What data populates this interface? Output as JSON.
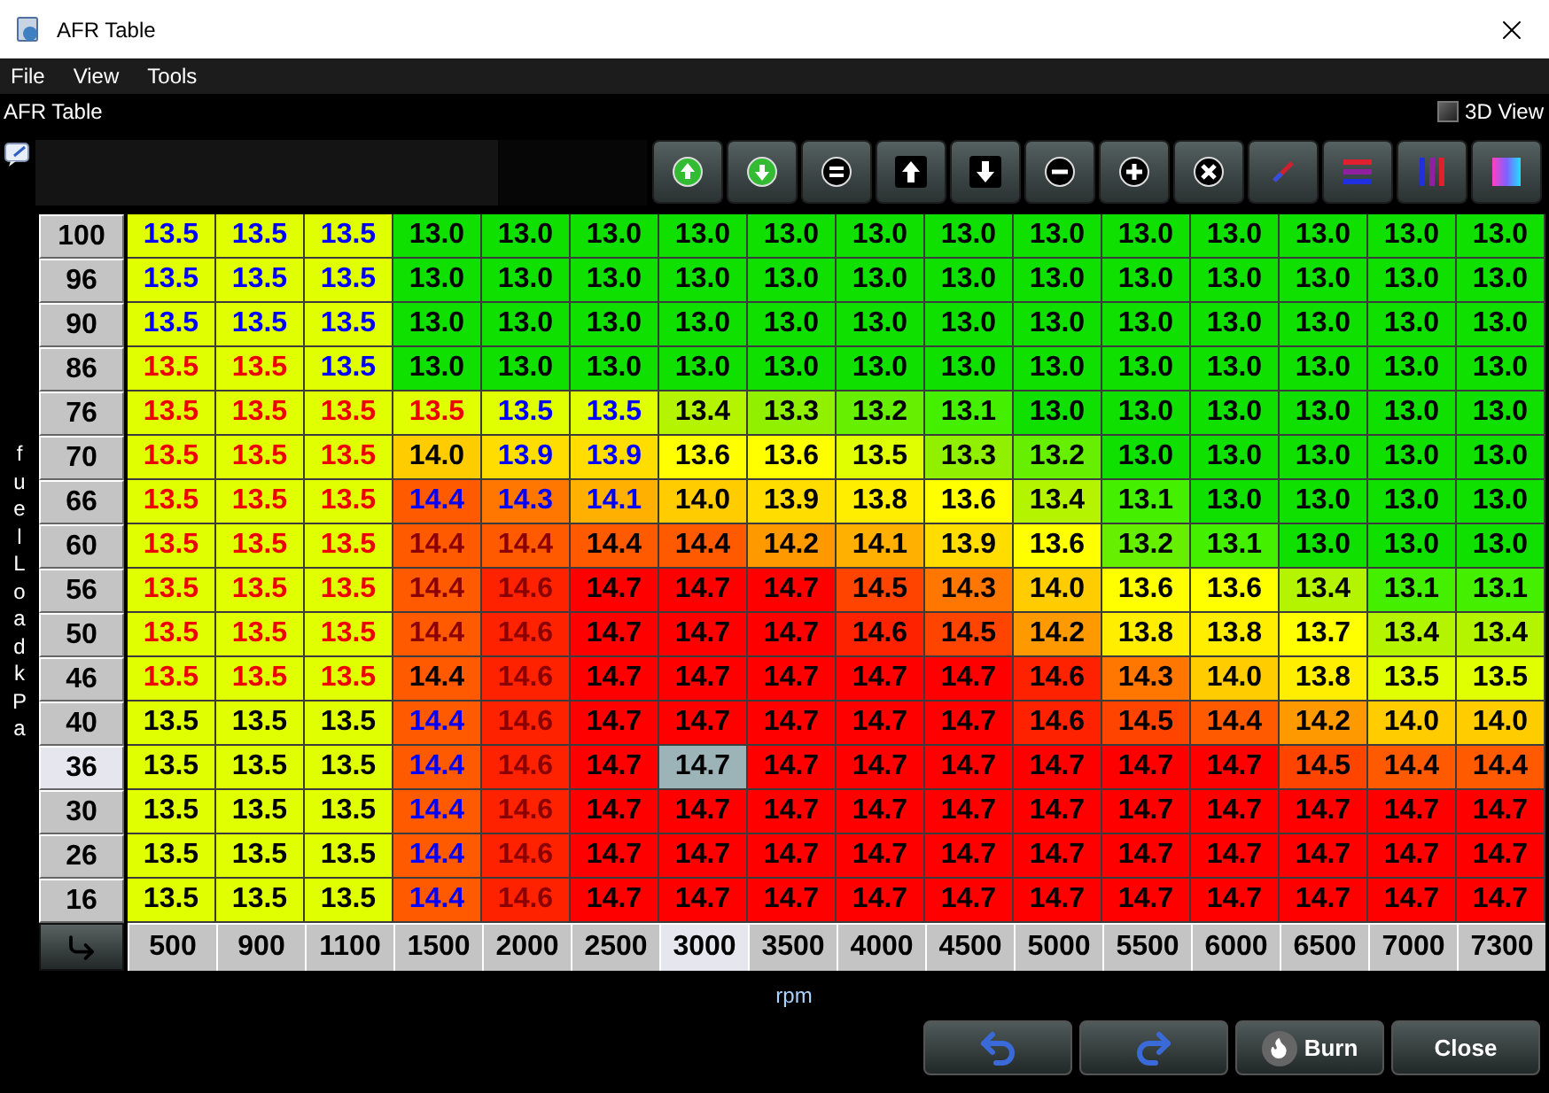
{
  "window": {
    "title": "AFR Table"
  },
  "menu": [
    {
      "label": "File"
    },
    {
      "label": "View"
    },
    {
      "label": "Tools"
    }
  ],
  "panel": {
    "title": "AFR Table",
    "view_toggle": {
      "label": "3D View",
      "checked": false
    }
  },
  "y_axis_label": "fuelLoad kPa",
  "x_axis_label": "rpm",
  "columns": [
    {
      "label": "500",
      "selected": false
    },
    {
      "label": "900",
      "selected": false
    },
    {
      "label": "1100",
      "selected": false
    },
    {
      "label": "1500",
      "selected": false
    },
    {
      "label": "2000",
      "selected": false
    },
    {
      "label": "2500",
      "selected": false
    },
    {
      "label": "3000",
      "selected": true
    },
    {
      "label": "3500",
      "selected": false
    },
    {
      "label": "4000",
      "selected": false
    },
    {
      "label": "4500",
      "selected": false
    },
    {
      "label": "5000",
      "selected": false
    },
    {
      "label": "5500",
      "selected": false
    },
    {
      "label": "6000",
      "selected": false
    },
    {
      "label": "6500",
      "selected": false
    },
    {
      "label": "7000",
      "selected": false
    },
    {
      "label": "7300",
      "selected": false
    }
  ],
  "rows": [
    {
      "label": "100",
      "selected": false,
      "cells": [
        {
          "value": "13.5",
          "color": "#e0ff00",
          "kind": "blue"
        },
        {
          "value": "13.5",
          "color": "#e0ff00",
          "kind": "blue"
        },
        {
          "value": "13.5",
          "color": "#e0ff00",
          "kind": "blue"
        },
        {
          "value": "13.0",
          "color": "#10e000",
          "kind": "plain"
        },
        {
          "value": "13.0",
          "color": "#10e000",
          "kind": "plain"
        },
        {
          "value": "13.0",
          "color": "#10e000",
          "kind": "plain"
        },
        {
          "value": "13.0",
          "color": "#10e000",
          "kind": "plain"
        },
        {
          "value": "13.0",
          "color": "#10e000",
          "kind": "plain"
        },
        {
          "value": "13.0",
          "color": "#10e000",
          "kind": "plain"
        },
        {
          "value": "13.0",
          "color": "#10e000",
          "kind": "plain"
        },
        {
          "value": "13.0",
          "color": "#10e000",
          "kind": "plain"
        },
        {
          "value": "13.0",
          "color": "#10e000",
          "kind": "plain"
        },
        {
          "value": "13.0",
          "color": "#10e000",
          "kind": "plain"
        },
        {
          "value": "13.0",
          "color": "#10e000",
          "kind": "plain"
        },
        {
          "value": "13.0",
          "color": "#10e000",
          "kind": "plain"
        },
        {
          "value": "13.0",
          "color": "#10e000",
          "kind": "plain"
        }
      ]
    },
    {
      "label": "96",
      "selected": false,
      "cells": [
        {
          "value": "13.5",
          "color": "#e0ff00",
          "kind": "blue"
        },
        {
          "value": "13.5",
          "color": "#e0ff00",
          "kind": "blue"
        },
        {
          "value": "13.5",
          "color": "#e0ff00",
          "kind": "blue"
        },
        {
          "value": "13.0",
          "color": "#10e000",
          "kind": "plain"
        },
        {
          "value": "13.0",
          "color": "#10e000",
          "kind": "plain"
        },
        {
          "value": "13.0",
          "color": "#10e000",
          "kind": "plain"
        },
        {
          "value": "13.0",
          "color": "#10e000",
          "kind": "plain"
        },
        {
          "value": "13.0",
          "color": "#10e000",
          "kind": "plain"
        },
        {
          "value": "13.0",
          "color": "#10e000",
          "kind": "plain"
        },
        {
          "value": "13.0",
          "color": "#10e000",
          "kind": "plain"
        },
        {
          "value": "13.0",
          "color": "#10e000",
          "kind": "plain"
        },
        {
          "value": "13.0",
          "color": "#10e000",
          "kind": "plain"
        },
        {
          "value": "13.0",
          "color": "#10e000",
          "kind": "plain"
        },
        {
          "value": "13.0",
          "color": "#10e000",
          "kind": "plain"
        },
        {
          "value": "13.0",
          "color": "#10e000",
          "kind": "plain"
        },
        {
          "value": "13.0",
          "color": "#10e000",
          "kind": "plain"
        }
      ]
    },
    {
      "label": "90",
      "selected": false,
      "cells": [
        {
          "value": "13.5",
          "color": "#e0ff00",
          "kind": "blue"
        },
        {
          "value": "13.5",
          "color": "#e0ff00",
          "kind": "blue"
        },
        {
          "value": "13.5",
          "color": "#e0ff00",
          "kind": "blue"
        },
        {
          "value": "13.0",
          "color": "#10e000",
          "kind": "plain"
        },
        {
          "value": "13.0",
          "color": "#10e000",
          "kind": "plain"
        },
        {
          "value": "13.0",
          "color": "#10e000",
          "kind": "plain"
        },
        {
          "value": "13.0",
          "color": "#10e000",
          "kind": "plain"
        },
        {
          "value": "13.0",
          "color": "#10e000",
          "kind": "plain"
        },
        {
          "value": "13.0",
          "color": "#10e000",
          "kind": "plain"
        },
        {
          "value": "13.0",
          "color": "#10e000",
          "kind": "plain"
        },
        {
          "value": "13.0",
          "color": "#10e000",
          "kind": "plain"
        },
        {
          "value": "13.0",
          "color": "#10e000",
          "kind": "plain"
        },
        {
          "value": "13.0",
          "color": "#10e000",
          "kind": "plain"
        },
        {
          "value": "13.0",
          "color": "#10e000",
          "kind": "plain"
        },
        {
          "value": "13.0",
          "color": "#10e000",
          "kind": "plain"
        },
        {
          "value": "13.0",
          "color": "#10e000",
          "kind": "plain"
        }
      ]
    },
    {
      "label": "86",
      "selected": false,
      "cells": [
        {
          "value": "13.5",
          "color": "#e0ff00",
          "kind": "red"
        },
        {
          "value": "13.5",
          "color": "#e0ff00",
          "kind": "red"
        },
        {
          "value": "13.5",
          "color": "#e0ff00",
          "kind": "blue"
        },
        {
          "value": "13.0",
          "color": "#10e000",
          "kind": "plain"
        },
        {
          "value": "13.0",
          "color": "#10e000",
          "kind": "plain"
        },
        {
          "value": "13.0",
          "color": "#10e000",
          "kind": "plain"
        },
        {
          "value": "13.0",
          "color": "#10e000",
          "kind": "plain"
        },
        {
          "value": "13.0",
          "color": "#10e000",
          "kind": "plain"
        },
        {
          "value": "13.0",
          "color": "#10e000",
          "kind": "plain"
        },
        {
          "value": "13.0",
          "color": "#10e000",
          "kind": "plain"
        },
        {
          "value": "13.0",
          "color": "#10e000",
          "kind": "plain"
        },
        {
          "value": "13.0",
          "color": "#10e000",
          "kind": "plain"
        },
        {
          "value": "13.0",
          "color": "#10e000",
          "kind": "plain"
        },
        {
          "value": "13.0",
          "color": "#10e000",
          "kind": "plain"
        },
        {
          "value": "13.0",
          "color": "#10e000",
          "kind": "plain"
        },
        {
          "value": "13.0",
          "color": "#10e000",
          "kind": "plain"
        }
      ]
    },
    {
      "label": "76",
      "selected": false,
      "cells": [
        {
          "value": "13.5",
          "color": "#e0ff00",
          "kind": "red"
        },
        {
          "value": "13.5",
          "color": "#e0ff00",
          "kind": "red"
        },
        {
          "value": "13.5",
          "color": "#e0ff00",
          "kind": "red"
        },
        {
          "value": "13.5",
          "color": "#e0ff00",
          "kind": "red"
        },
        {
          "value": "13.5",
          "color": "#e0ff00",
          "kind": "blue"
        },
        {
          "value": "13.5",
          "color": "#e0ff00",
          "kind": "blue"
        },
        {
          "value": "13.4",
          "color": "#b4f400",
          "kind": "plain"
        },
        {
          "value": "13.3",
          "color": "#90f000",
          "kind": "plain"
        },
        {
          "value": "13.2",
          "color": "#66f000",
          "kind": "plain"
        },
        {
          "value": "13.1",
          "color": "#44f000",
          "kind": "plain"
        },
        {
          "value": "13.0",
          "color": "#10e000",
          "kind": "plain"
        },
        {
          "value": "13.0",
          "color": "#10e000",
          "kind": "plain"
        },
        {
          "value": "13.0",
          "color": "#10e000",
          "kind": "plain"
        },
        {
          "value": "13.0",
          "color": "#10e000",
          "kind": "plain"
        },
        {
          "value": "13.0",
          "color": "#10e000",
          "kind": "plain"
        },
        {
          "value": "13.0",
          "color": "#10e000",
          "kind": "plain"
        }
      ]
    },
    {
      "label": "70",
      "selected": false,
      "cells": [
        {
          "value": "13.5",
          "color": "#e0ff00",
          "kind": "red"
        },
        {
          "value": "13.5",
          "color": "#e0ff00",
          "kind": "red"
        },
        {
          "value": "13.5",
          "color": "#e0ff00",
          "kind": "red"
        },
        {
          "value": "14.0",
          "color": "#ffcc00",
          "kind": "plain"
        },
        {
          "value": "13.9",
          "color": "#ffdd00",
          "kind": "blue"
        },
        {
          "value": "13.9",
          "color": "#ffdd00",
          "kind": "blue"
        },
        {
          "value": "13.6",
          "color": "#ffff00",
          "kind": "plain"
        },
        {
          "value": "13.6",
          "color": "#ffff00",
          "kind": "plain"
        },
        {
          "value": "13.5",
          "color": "#e0ff00",
          "kind": "plain"
        },
        {
          "value": "13.3",
          "color": "#90f000",
          "kind": "plain"
        },
        {
          "value": "13.2",
          "color": "#66f000",
          "kind": "plain"
        },
        {
          "value": "13.0",
          "color": "#10e000",
          "kind": "plain"
        },
        {
          "value": "13.0",
          "color": "#10e000",
          "kind": "plain"
        },
        {
          "value": "13.0",
          "color": "#10e000",
          "kind": "plain"
        },
        {
          "value": "13.0",
          "color": "#10e000",
          "kind": "plain"
        },
        {
          "value": "13.0",
          "color": "#10e000",
          "kind": "plain"
        }
      ]
    },
    {
      "label": "66",
      "selected": false,
      "cells": [
        {
          "value": "13.5",
          "color": "#e0ff00",
          "kind": "red"
        },
        {
          "value": "13.5",
          "color": "#e0ff00",
          "kind": "red"
        },
        {
          "value": "13.5",
          "color": "#e0ff00",
          "kind": "red"
        },
        {
          "value": "14.4",
          "color": "#ff5a00",
          "kind": "blue"
        },
        {
          "value": "14.3",
          "color": "#ff7700",
          "kind": "blue"
        },
        {
          "value": "14.1",
          "color": "#ffb000",
          "kind": "blue"
        },
        {
          "value": "14.0",
          "color": "#ffcc00",
          "kind": "plain"
        },
        {
          "value": "13.9",
          "color": "#ffdd00",
          "kind": "plain"
        },
        {
          "value": "13.8",
          "color": "#ffee00",
          "kind": "plain"
        },
        {
          "value": "13.6",
          "color": "#ffff00",
          "kind": "plain"
        },
        {
          "value": "13.4",
          "color": "#b4f400",
          "kind": "plain"
        },
        {
          "value": "13.1",
          "color": "#44f000",
          "kind": "plain"
        },
        {
          "value": "13.0",
          "color": "#10e000",
          "kind": "plain"
        },
        {
          "value": "13.0",
          "color": "#10e000",
          "kind": "plain"
        },
        {
          "value": "13.0",
          "color": "#10e000",
          "kind": "plain"
        },
        {
          "value": "13.0",
          "color": "#10e000",
          "kind": "plain"
        }
      ]
    },
    {
      "label": "60",
      "selected": false,
      "cells": [
        {
          "value": "13.5",
          "color": "#e0ff00",
          "kind": "red"
        },
        {
          "value": "13.5",
          "color": "#e0ff00",
          "kind": "red"
        },
        {
          "value": "13.5",
          "color": "#e0ff00",
          "kind": "red"
        },
        {
          "value": "14.4",
          "color": "#ff5a00",
          "kind": "dim"
        },
        {
          "value": "14.4",
          "color": "#ff5a00",
          "kind": "dim"
        },
        {
          "value": "14.4",
          "color": "#ff5a00",
          "kind": "plain"
        },
        {
          "value": "14.4",
          "color": "#ff5a00",
          "kind": "plain"
        },
        {
          "value": "14.2",
          "color": "#ff9900",
          "kind": "plain"
        },
        {
          "value": "14.1",
          "color": "#ffb000",
          "kind": "plain"
        },
        {
          "value": "13.9",
          "color": "#ffdd00",
          "kind": "plain"
        },
        {
          "value": "13.6",
          "color": "#ffff00",
          "kind": "plain"
        },
        {
          "value": "13.2",
          "color": "#66f000",
          "kind": "plain"
        },
        {
          "value": "13.1",
          "color": "#44f000",
          "kind": "plain"
        },
        {
          "value": "13.0",
          "color": "#10e000",
          "kind": "plain"
        },
        {
          "value": "13.0",
          "color": "#10e000",
          "kind": "plain"
        },
        {
          "value": "13.0",
          "color": "#10e000",
          "kind": "plain"
        }
      ]
    },
    {
      "label": "56",
      "selected": false,
      "cells": [
        {
          "value": "13.5",
          "color": "#e0ff00",
          "kind": "red"
        },
        {
          "value": "13.5",
          "color": "#e0ff00",
          "kind": "red"
        },
        {
          "value": "13.5",
          "color": "#e0ff00",
          "kind": "red"
        },
        {
          "value": "14.4",
          "color": "#ff5a00",
          "kind": "dim"
        },
        {
          "value": "14.6",
          "color": "#ff2200",
          "kind": "dim"
        },
        {
          "value": "14.7",
          "color": "#ff0000",
          "kind": "plain"
        },
        {
          "value": "14.7",
          "color": "#ff0000",
          "kind": "plain"
        },
        {
          "value": "14.7",
          "color": "#ff0000",
          "kind": "plain"
        },
        {
          "value": "14.5",
          "color": "#ff4400",
          "kind": "plain"
        },
        {
          "value": "14.3",
          "color": "#ff7700",
          "kind": "plain"
        },
        {
          "value": "14.0",
          "color": "#ffcc00",
          "kind": "plain"
        },
        {
          "value": "13.6",
          "color": "#ffff00",
          "kind": "plain"
        },
        {
          "value": "13.6",
          "color": "#ffff00",
          "kind": "plain"
        },
        {
          "value": "13.4",
          "color": "#b4f400",
          "kind": "plain"
        },
        {
          "value": "13.1",
          "color": "#44f000",
          "kind": "plain"
        },
        {
          "value": "13.1",
          "color": "#44f000",
          "kind": "plain"
        }
      ]
    },
    {
      "label": "50",
      "selected": false,
      "cells": [
        {
          "value": "13.5",
          "color": "#e0ff00",
          "kind": "red"
        },
        {
          "value": "13.5",
          "color": "#e0ff00",
          "kind": "red"
        },
        {
          "value": "13.5",
          "color": "#e0ff00",
          "kind": "red"
        },
        {
          "value": "14.4",
          "color": "#ff5a00",
          "kind": "dim"
        },
        {
          "value": "14.6",
          "color": "#ff2200",
          "kind": "dim"
        },
        {
          "value": "14.7",
          "color": "#ff0000",
          "kind": "plain"
        },
        {
          "value": "14.7",
          "color": "#ff0000",
          "kind": "plain"
        },
        {
          "value": "14.7",
          "color": "#ff0000",
          "kind": "plain"
        },
        {
          "value": "14.6",
          "color": "#ff2200",
          "kind": "plain"
        },
        {
          "value": "14.5",
          "color": "#ff4400",
          "kind": "plain"
        },
        {
          "value": "14.2",
          "color": "#ff9900",
          "kind": "plain"
        },
        {
          "value": "13.8",
          "color": "#ffee00",
          "kind": "plain"
        },
        {
          "value": "13.8",
          "color": "#ffee00",
          "kind": "plain"
        },
        {
          "value": "13.7",
          "color": "#ffff00",
          "kind": "plain"
        },
        {
          "value": "13.4",
          "color": "#b4f400",
          "kind": "plain"
        },
        {
          "value": "13.4",
          "color": "#b4f400",
          "kind": "plain"
        }
      ]
    },
    {
      "label": "46",
      "selected": false,
      "cells": [
        {
          "value": "13.5",
          "color": "#e0ff00",
          "kind": "red"
        },
        {
          "value": "13.5",
          "color": "#e0ff00",
          "kind": "red"
        },
        {
          "value": "13.5",
          "color": "#e0ff00",
          "kind": "red"
        },
        {
          "value": "14.4",
          "color": "#ff5a00",
          "kind": "plain"
        },
        {
          "value": "14.6",
          "color": "#ff2200",
          "kind": "dim"
        },
        {
          "value": "14.7",
          "color": "#ff0000",
          "kind": "plain"
        },
        {
          "value": "14.7",
          "color": "#ff0000",
          "kind": "plain"
        },
        {
          "value": "14.7",
          "color": "#ff0000",
          "kind": "plain"
        },
        {
          "value": "14.7",
          "color": "#ff0000",
          "kind": "plain"
        },
        {
          "value": "14.7",
          "color": "#ff0000",
          "kind": "plain"
        },
        {
          "value": "14.6",
          "color": "#ff2200",
          "kind": "plain"
        },
        {
          "value": "14.3",
          "color": "#ff7700",
          "kind": "plain"
        },
        {
          "value": "14.0",
          "color": "#ffcc00",
          "kind": "plain"
        },
        {
          "value": "13.8",
          "color": "#ffee00",
          "kind": "plain"
        },
        {
          "value": "13.5",
          "color": "#e0ff00",
          "kind": "plain"
        },
        {
          "value": "13.5",
          "color": "#e0ff00",
          "kind": "plain"
        }
      ]
    },
    {
      "label": "40",
      "selected": false,
      "cells": [
        {
          "value": "13.5",
          "color": "#e0ff00",
          "kind": "plain"
        },
        {
          "value": "13.5",
          "color": "#e0ff00",
          "kind": "plain"
        },
        {
          "value": "13.5",
          "color": "#e0ff00",
          "kind": "plain"
        },
        {
          "value": "14.4",
          "color": "#ff5a00",
          "kind": "blue"
        },
        {
          "value": "14.6",
          "color": "#ff2200",
          "kind": "dim"
        },
        {
          "value": "14.7",
          "color": "#ff0000",
          "kind": "plain"
        },
        {
          "value": "14.7",
          "color": "#ff0000",
          "kind": "plain"
        },
        {
          "value": "14.7",
          "color": "#ff0000",
          "kind": "plain"
        },
        {
          "value": "14.7",
          "color": "#ff0000",
          "kind": "plain"
        },
        {
          "value": "14.7",
          "color": "#ff0000",
          "kind": "plain"
        },
        {
          "value": "14.6",
          "color": "#ff2200",
          "kind": "plain"
        },
        {
          "value": "14.5",
          "color": "#ff4400",
          "kind": "plain"
        },
        {
          "value": "14.4",
          "color": "#ff5a00",
          "kind": "plain"
        },
        {
          "value": "14.2",
          "color": "#ff9900",
          "kind": "plain"
        },
        {
          "value": "14.0",
          "color": "#ffcc00",
          "kind": "plain"
        },
        {
          "value": "14.0",
          "color": "#ffcc00",
          "kind": "plain"
        }
      ]
    },
    {
      "label": "36",
      "selected": true,
      "cells": [
        {
          "value": "13.5",
          "color": "#e0ff00",
          "kind": "plain"
        },
        {
          "value": "13.5",
          "color": "#e0ff00",
          "kind": "plain"
        },
        {
          "value": "13.5",
          "color": "#e0ff00",
          "kind": "plain"
        },
        {
          "value": "14.4",
          "color": "#ff5a00",
          "kind": "blue"
        },
        {
          "value": "14.6",
          "color": "#ff2200",
          "kind": "dim"
        },
        {
          "value": "14.7",
          "color": "#ff0000",
          "kind": "plain"
        },
        {
          "value": "14.7",
          "color": "#9cb4b8",
          "kind": "plain"
        },
        {
          "value": "14.7",
          "color": "#ff0000",
          "kind": "plain"
        },
        {
          "value": "14.7",
          "color": "#ff0000",
          "kind": "plain"
        },
        {
          "value": "14.7",
          "color": "#ff0000",
          "kind": "plain"
        },
        {
          "value": "14.7",
          "color": "#ff0000",
          "kind": "plain"
        },
        {
          "value": "14.7",
          "color": "#ff0000",
          "kind": "plain"
        },
        {
          "value": "14.7",
          "color": "#ff0000",
          "kind": "plain"
        },
        {
          "value": "14.5",
          "color": "#ff4400",
          "kind": "plain"
        },
        {
          "value": "14.4",
          "color": "#ff5a00",
          "kind": "plain"
        },
        {
          "value": "14.4",
          "color": "#ff5a00",
          "kind": "plain"
        }
      ]
    },
    {
      "label": "30",
      "selected": false,
      "cells": [
        {
          "value": "13.5",
          "color": "#e0ff00",
          "kind": "plain"
        },
        {
          "value": "13.5",
          "color": "#e0ff00",
          "kind": "plain"
        },
        {
          "value": "13.5",
          "color": "#e0ff00",
          "kind": "plain"
        },
        {
          "value": "14.4",
          "color": "#ff5a00",
          "kind": "blue"
        },
        {
          "value": "14.6",
          "color": "#ff2200",
          "kind": "dim"
        },
        {
          "value": "14.7",
          "color": "#ff0000",
          "kind": "plain"
        },
        {
          "value": "14.7",
          "color": "#ff0000",
          "kind": "plain"
        },
        {
          "value": "14.7",
          "color": "#ff0000",
          "kind": "plain"
        },
        {
          "value": "14.7",
          "color": "#ff0000",
          "kind": "plain"
        },
        {
          "value": "14.7",
          "color": "#ff0000",
          "kind": "plain"
        },
        {
          "value": "14.7",
          "color": "#ff0000",
          "kind": "plain"
        },
        {
          "value": "14.7",
          "color": "#ff0000",
          "kind": "plain"
        },
        {
          "value": "14.7",
          "color": "#ff0000",
          "kind": "plain"
        },
        {
          "value": "14.7",
          "color": "#ff0000",
          "kind": "plain"
        },
        {
          "value": "14.7",
          "color": "#ff0000",
          "kind": "plain"
        },
        {
          "value": "14.7",
          "color": "#ff0000",
          "kind": "plain"
        }
      ]
    },
    {
      "label": "26",
      "selected": false,
      "cells": [
        {
          "value": "13.5",
          "color": "#e0ff00",
          "kind": "plain"
        },
        {
          "value": "13.5",
          "color": "#e0ff00",
          "kind": "plain"
        },
        {
          "value": "13.5",
          "color": "#e0ff00",
          "kind": "plain"
        },
        {
          "value": "14.4",
          "color": "#ff5a00",
          "kind": "blue"
        },
        {
          "value": "14.6",
          "color": "#ff2200",
          "kind": "dim"
        },
        {
          "value": "14.7",
          "color": "#ff0000",
          "kind": "plain"
        },
        {
          "value": "14.7",
          "color": "#ff0000",
          "kind": "plain"
        },
        {
          "value": "14.7",
          "color": "#ff0000",
          "kind": "plain"
        },
        {
          "value": "14.7",
          "color": "#ff0000",
          "kind": "plain"
        },
        {
          "value": "14.7",
          "color": "#ff0000",
          "kind": "plain"
        },
        {
          "value": "14.7",
          "color": "#ff0000",
          "kind": "plain"
        },
        {
          "value": "14.7",
          "color": "#ff0000",
          "kind": "plain"
        },
        {
          "value": "14.7",
          "color": "#ff0000",
          "kind": "plain"
        },
        {
          "value": "14.7",
          "color": "#ff0000",
          "kind": "plain"
        },
        {
          "value": "14.7",
          "color": "#ff0000",
          "kind": "plain"
        },
        {
          "value": "14.7",
          "color": "#ff0000",
          "kind": "plain"
        }
      ]
    },
    {
      "label": "16",
      "selected": false,
      "cells": [
        {
          "value": "13.5",
          "color": "#e0ff00",
          "kind": "plain"
        },
        {
          "value": "13.5",
          "color": "#e0ff00",
          "kind": "plain"
        },
        {
          "value": "13.5",
          "color": "#e0ff00",
          "kind": "plain"
        },
        {
          "value": "14.4",
          "color": "#ff5a00",
          "kind": "blue"
        },
        {
          "value": "14.6",
          "color": "#ff2200",
          "kind": "dim"
        },
        {
          "value": "14.7",
          "color": "#ff0000",
          "kind": "plain"
        },
        {
          "value": "14.7",
          "color": "#ff0000",
          "kind": "plain"
        },
        {
          "value": "14.7",
          "color": "#ff0000",
          "kind": "plain"
        },
        {
          "value": "14.7",
          "color": "#ff0000",
          "kind": "plain"
        },
        {
          "value": "14.7",
          "color": "#ff0000",
          "kind": "plain"
        },
        {
          "value": "14.7",
          "color": "#ff0000",
          "kind": "plain"
        },
        {
          "value": "14.7",
          "color": "#ff0000",
          "kind": "plain"
        },
        {
          "value": "14.7",
          "color": "#ff0000",
          "kind": "plain"
        },
        {
          "value": "14.7",
          "color": "#ff0000",
          "kind": "plain"
        },
        {
          "value": "14.7",
          "color": "#ff0000",
          "kind": "plain"
        },
        {
          "value": "14.7",
          "color": "#ff0000",
          "kind": "plain"
        }
      ]
    }
  ],
  "buttons": [
    {
      "kind": "undo"
    },
    {
      "kind": "redo"
    },
    {
      "kind": "burn",
      "label": "Burn"
    },
    {
      "kind": "close",
      "label": "Close"
    }
  ]
}
